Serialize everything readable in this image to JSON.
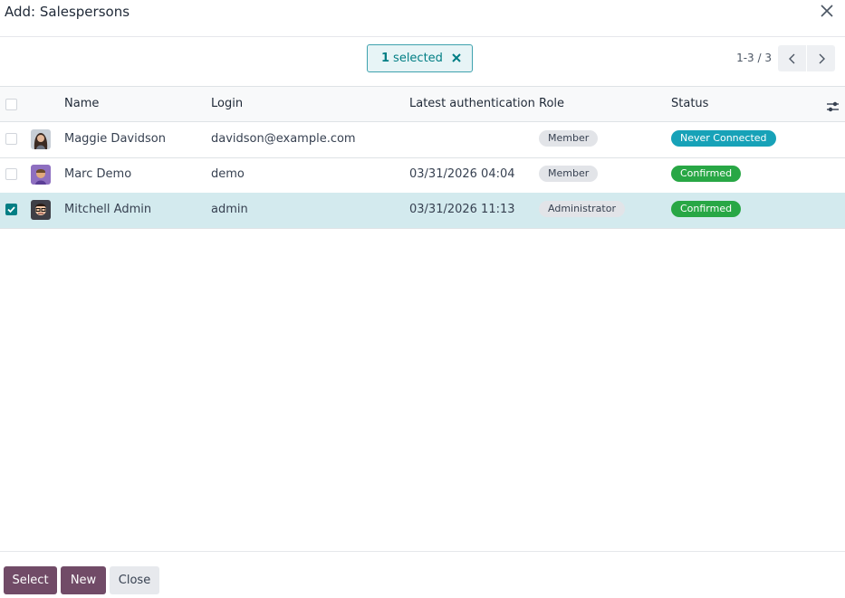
{
  "dialog": {
    "title": "Add: Salespersons"
  },
  "selection": {
    "count": "1",
    "label": "selected"
  },
  "pager": {
    "text": "1-3 / 3"
  },
  "columns": {
    "name": "Name",
    "login": "Login",
    "latest_auth": "Latest authentication",
    "role": "Role",
    "status": "Status"
  },
  "rows": [
    {
      "name": "Maggie Davidson",
      "login": "davidson@example.com",
      "latest_auth": "",
      "role": "Member",
      "status": "Never Connected",
      "checked": false
    },
    {
      "name": "Marc Demo",
      "login": "demo",
      "latest_auth": "03/31/2026 04:04",
      "role": "Member",
      "status": "Confirmed",
      "checked": false
    },
    {
      "name": "Mitchell Admin",
      "login": "admin",
      "latest_auth": "03/31/2026 11:13",
      "role": "Administrator",
      "status": "Confirmed",
      "checked": true
    }
  ],
  "footer": {
    "select": "Select",
    "new": "New",
    "close": "Close"
  },
  "colors": {
    "primary": "#714b67",
    "accent_teal": "#017e84",
    "status_never": "#17a2b8",
    "status_confirmed": "#28a745",
    "selected_row": "#d3eaee"
  },
  "icons": {
    "close": "close-icon",
    "clear_selection": "x-icon",
    "prev": "chevron-left-icon",
    "next": "chevron-right-icon",
    "optional_columns": "sliders-icon",
    "checkbox_check": "check-icon"
  }
}
